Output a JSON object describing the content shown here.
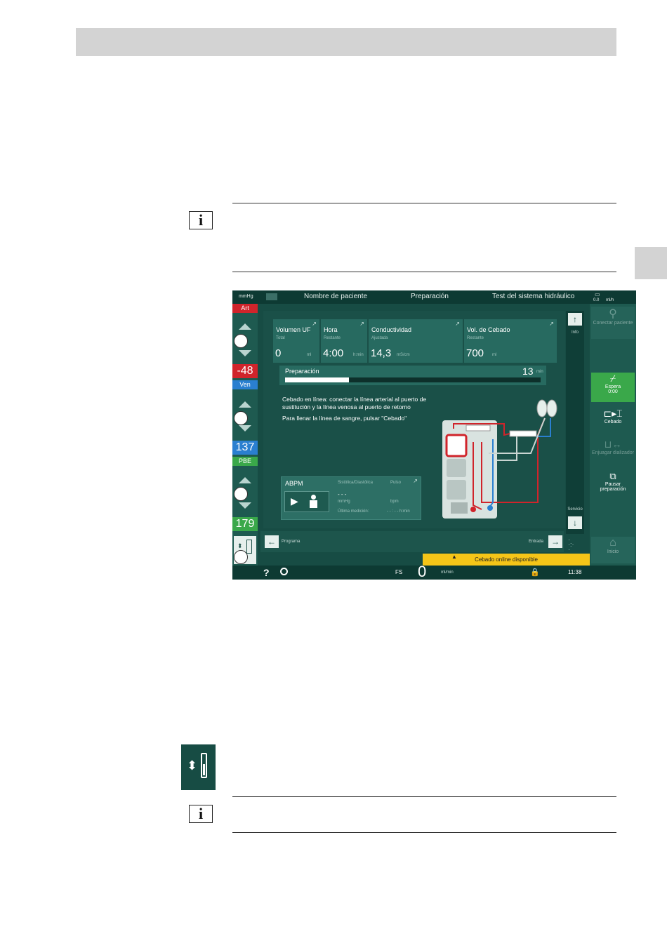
{
  "screen": {
    "topbar": {
      "unit": "mmHg",
      "patient_name": "Nombre de paciente",
      "phase": "Preparación",
      "test": "Test del sistema hidráulico",
      "right_value": "0.0",
      "right_unit": "ml/h"
    },
    "left": {
      "art_label": "Art",
      "art_value": "-48",
      "ven_label": "Ven",
      "ven_value": "137",
      "pbe_label": "PBE",
      "pbe_value": "179"
    },
    "params": [
      {
        "title": "Volumen UF",
        "sub": "Total",
        "value": "0",
        "unit": "ml"
      },
      {
        "title": "Hora",
        "sub": "Restante",
        "value": "4:00",
        "unit": "h:min"
      },
      {
        "title": "Conductividad",
        "sub": "Ajustada",
        "value": "14,3",
        "unit": "mS/cm"
      },
      {
        "title": "Vol. de Cebado",
        "sub": "Restante",
        "value": "700",
        "unit": "ml"
      }
    ],
    "progress": {
      "label": "Preparación",
      "value": "13",
      "unit": "min",
      "fraction": 0.25
    },
    "message": {
      "line1": "Cebado en línea: conectar la línea arterial al puerto de",
      "line2": "sustitución y la línea venosa al puerto de retorno",
      "line3": "Para llenar la línea de sangre, pulsar \"Cebado\""
    },
    "abpm": {
      "title": "ABPM",
      "col1": "Sistólica/Diastólica",
      "col2": "Pulso",
      "dots": "- - -",
      "unit1": "mmHg",
      "unit2": "bpm",
      "last": "Última medición:",
      "last_value": "- - : - - h:min"
    },
    "scroll": {
      "info": "Info",
      "service": "Servicio"
    },
    "nav": {
      "back": "Programa",
      "forward": "Entrada"
    },
    "right": {
      "btn1": "Conectar paciente",
      "btn2_line1": "Espera",
      "btn2_line2": "0:00",
      "btn3": "Cebado",
      "btn4": "Enjuagar dializador",
      "btn5_line1": "Pausar",
      "btn5_line2": "preparación",
      "btn6": "Inicio"
    },
    "banner": "Cebado online disponible",
    "bottom": {
      "help": "?",
      "fs": "FS",
      "flow": "0",
      "flow_unit": "ml/min",
      "time": "11:38"
    }
  },
  "colors": {
    "screen_bg": "#174c44",
    "art_red": "#d0242b",
    "ven_blue": "#2a7fd0",
    "pbe_green": "#3aa84a",
    "banner_yellow": "#f5c518"
  }
}
